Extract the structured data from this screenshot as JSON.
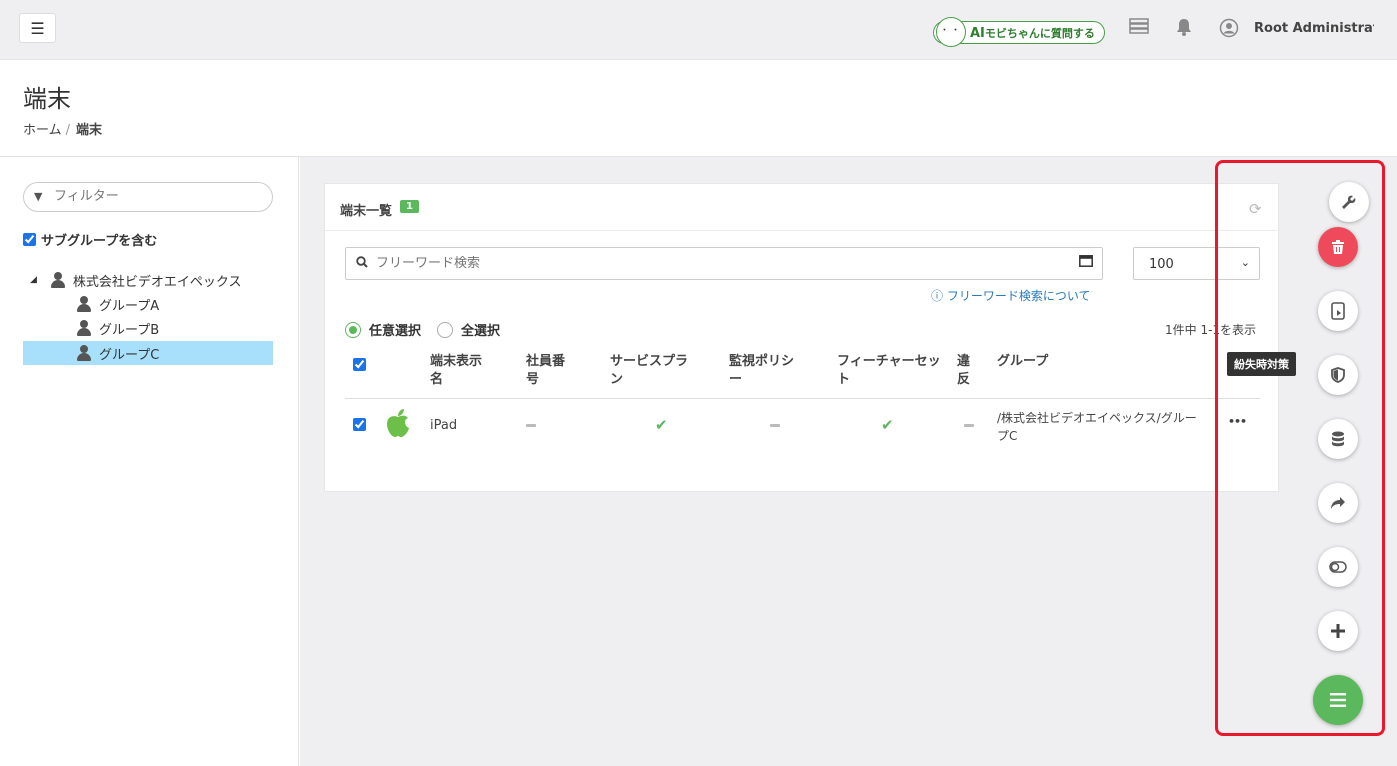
{
  "topbar": {
    "menu_icon": "hamburger-icon",
    "ai_face": "・・",
    "ai_prefix": "AI",
    "ai_label": "モビちゃんに質問する",
    "user_name": "Root Administrat..."
  },
  "page": {
    "title": "端末",
    "breadcrumb_home": "ホーム",
    "breadcrumb_sep": "/",
    "breadcrumb_current": "端末"
  },
  "sidebar": {
    "filter_placeholder": "フィルター",
    "include_subgroups": "サブグループを含む",
    "tree": {
      "root": "株式会社ビデオエイペックス",
      "children": [
        "グループA",
        "グループB",
        "グループC"
      ],
      "selected": "グループC"
    }
  },
  "card": {
    "title": "端末一覧",
    "badge": "1",
    "search_placeholder": "フリーワード検索",
    "per_page": "100",
    "search_help": "フリーワード検索について",
    "radio_any": "任意選択",
    "radio_all": "全選択",
    "count_text": "1件中 1-1を表示",
    "columns": [
      "端末表示名",
      "社員番号",
      "サービスプラン",
      "監視ポリシー",
      "フィーチャーセット",
      "違反",
      "グループ"
    ],
    "rows": [
      {
        "name": "iPad",
        "group": "/株式会社ビデオエイペックス/グループC",
        "more": "•••"
      }
    ]
  },
  "actions": {
    "tooltip": "紛失時対策",
    "icons": [
      "wrench-icon",
      "trash-icon",
      "device-icon",
      "shield-icon",
      "database-icon",
      "share-icon",
      "toggle-icon",
      "plus-icon",
      "menu-icon"
    ],
    "colors": {
      "delete": "#ef4a5c",
      "main": "#5cb85c",
      "frame": "#e8192c"
    }
  }
}
